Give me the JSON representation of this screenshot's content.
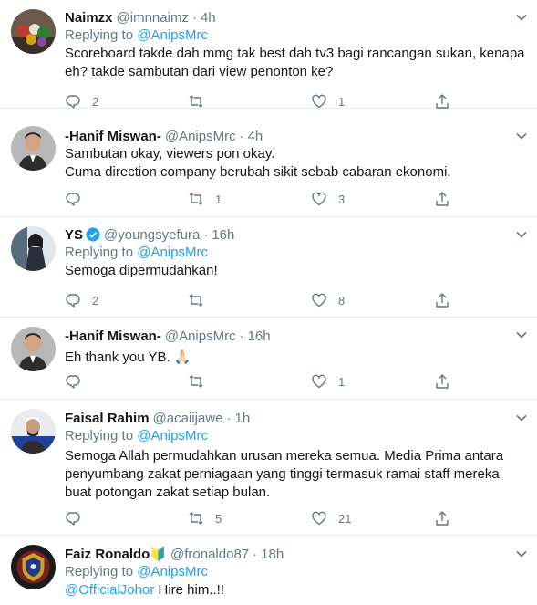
{
  "tweets": [
    {
      "name": "Naimzx",
      "handle": "@imnnaimz",
      "time": "4h",
      "replying_label": "Replying to",
      "replying_to": "@AnipsMrc",
      "text": "Scoreboard takde dah mmg tak best dah tv3 bagi rancangan sukan, kenapa eh? takde sambutan dari view penonton ke?",
      "replies": "2",
      "retweets": "",
      "likes": "1"
    },
    {
      "name": "-Hanif Miswan-",
      "handle": "@AnipsMrc",
      "time": "4h",
      "text_line1": "Sambutan okay, viewers pon okay.",
      "text_line2": "Cuma direction company berubah sikit sebab cabaran ekonomi.",
      "replies": "",
      "retweets": "1",
      "likes": "3"
    },
    {
      "name": "YS",
      "handle": "@youngsyefura",
      "time": "16h",
      "replying_label": "Replying to",
      "replying_to": "@AnipsMrc",
      "text": "Semoga dipermudahkan!",
      "replies": "2",
      "retweets": "",
      "likes": "8"
    },
    {
      "name": "-Hanif Miswan-",
      "handle": "@AnipsMrc",
      "time": "16h",
      "text": "Eh thank you YB. 🙏🏻",
      "replies": "",
      "retweets": "",
      "likes": "1"
    },
    {
      "name": "Faisal Rahim",
      "handle": "@acaiijawe",
      "time": "1h",
      "replying_label": "Replying to",
      "replying_to": "@AnipsMrc",
      "text": "Semoga Allah permudahkan urusan mereka semua. Media Prima antara penyumbang zakat perniagaan yang tinggi termasuk ramai staff mereka buat potongan zakat setiap bulan.",
      "replies": "",
      "retweets": "5",
      "likes": "21"
    },
    {
      "name": "Faiz Ronaldo🔰",
      "handle": "@fronaldo87",
      "time": "18h",
      "replying_label": "Replying to",
      "replying_to": "@AnipsMrc",
      "mention": "@OfficialJohor",
      "text_after": " Hire him..!!"
    }
  ],
  "separator": "·",
  "colors": {
    "accent": "#1da1f2",
    "muted": "#657786",
    "text": "#14171a",
    "border": "#e6ecf0"
  }
}
